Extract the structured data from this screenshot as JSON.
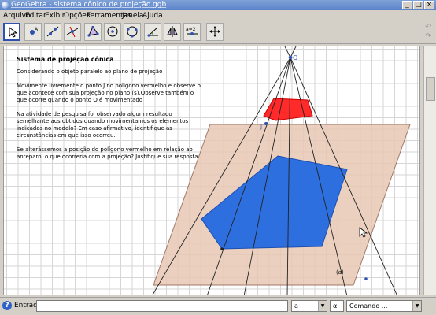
{
  "window": {
    "title": "GeoGebra - sistema cônico de projeção.ggb",
    "minimize_label": "_",
    "maximize_label": "□",
    "close_label": "×"
  },
  "menu": [
    "Arquivo",
    "Editar",
    "Exibir",
    "Opções",
    "Ferramentas",
    "Janela",
    "Ajuda"
  ],
  "toolbar": {
    "tools": [
      "move-tool",
      "point-tool",
      "line-tool",
      "perpendicular-line-tool",
      "polygon-tool",
      "circle-tool",
      "circle-three-points-tool",
      "angle-tool",
      "reflect-tool",
      "slider-tool",
      "move-graphics-tool"
    ],
    "undo_label": "↶",
    "redo_label": "↷"
  },
  "panel": {
    "heading": "Sistema de projeção cônica",
    "intro": "Considerando o objeto paralelo ao plano de projeção",
    "para1": "Movimente livremente o ponto J no polígono vermelho e observe o que acontece com sua projeção no plano (s).Observe também o que ocorre quando o ponto O é movimentado",
    "para2": "Na atividade de pesquisa foi observado algum resultado semelhante aos obtidos quando movimentamos os elementos indicados no modelo? Em caso afirmativo, identifique as circunstâncias em que isso ocorreu.",
    "para3": "Se alterássemos a posição do polígono vermelho em relação ao anteparo, o que ocorreria com a projeção? Justifique sua resposta."
  },
  "canvas": {
    "point_o_label": "O",
    "point_j_label": "J",
    "plane_label": "(a)",
    "colors": {
      "plane_fill": "#e8c8b4",
      "plane_stroke": "#a07868",
      "red_polygon": "#ff2a2a",
      "blue_polygon": "#2e6fe0",
      "lines": "#222222",
      "grid": "#d6d6d6"
    }
  },
  "input_bar": {
    "help_label": "?",
    "label": "Entrada:",
    "value": "",
    "combo1_value": "a",
    "combo2_value": "α",
    "combo3_value": "Comando ..."
  }
}
